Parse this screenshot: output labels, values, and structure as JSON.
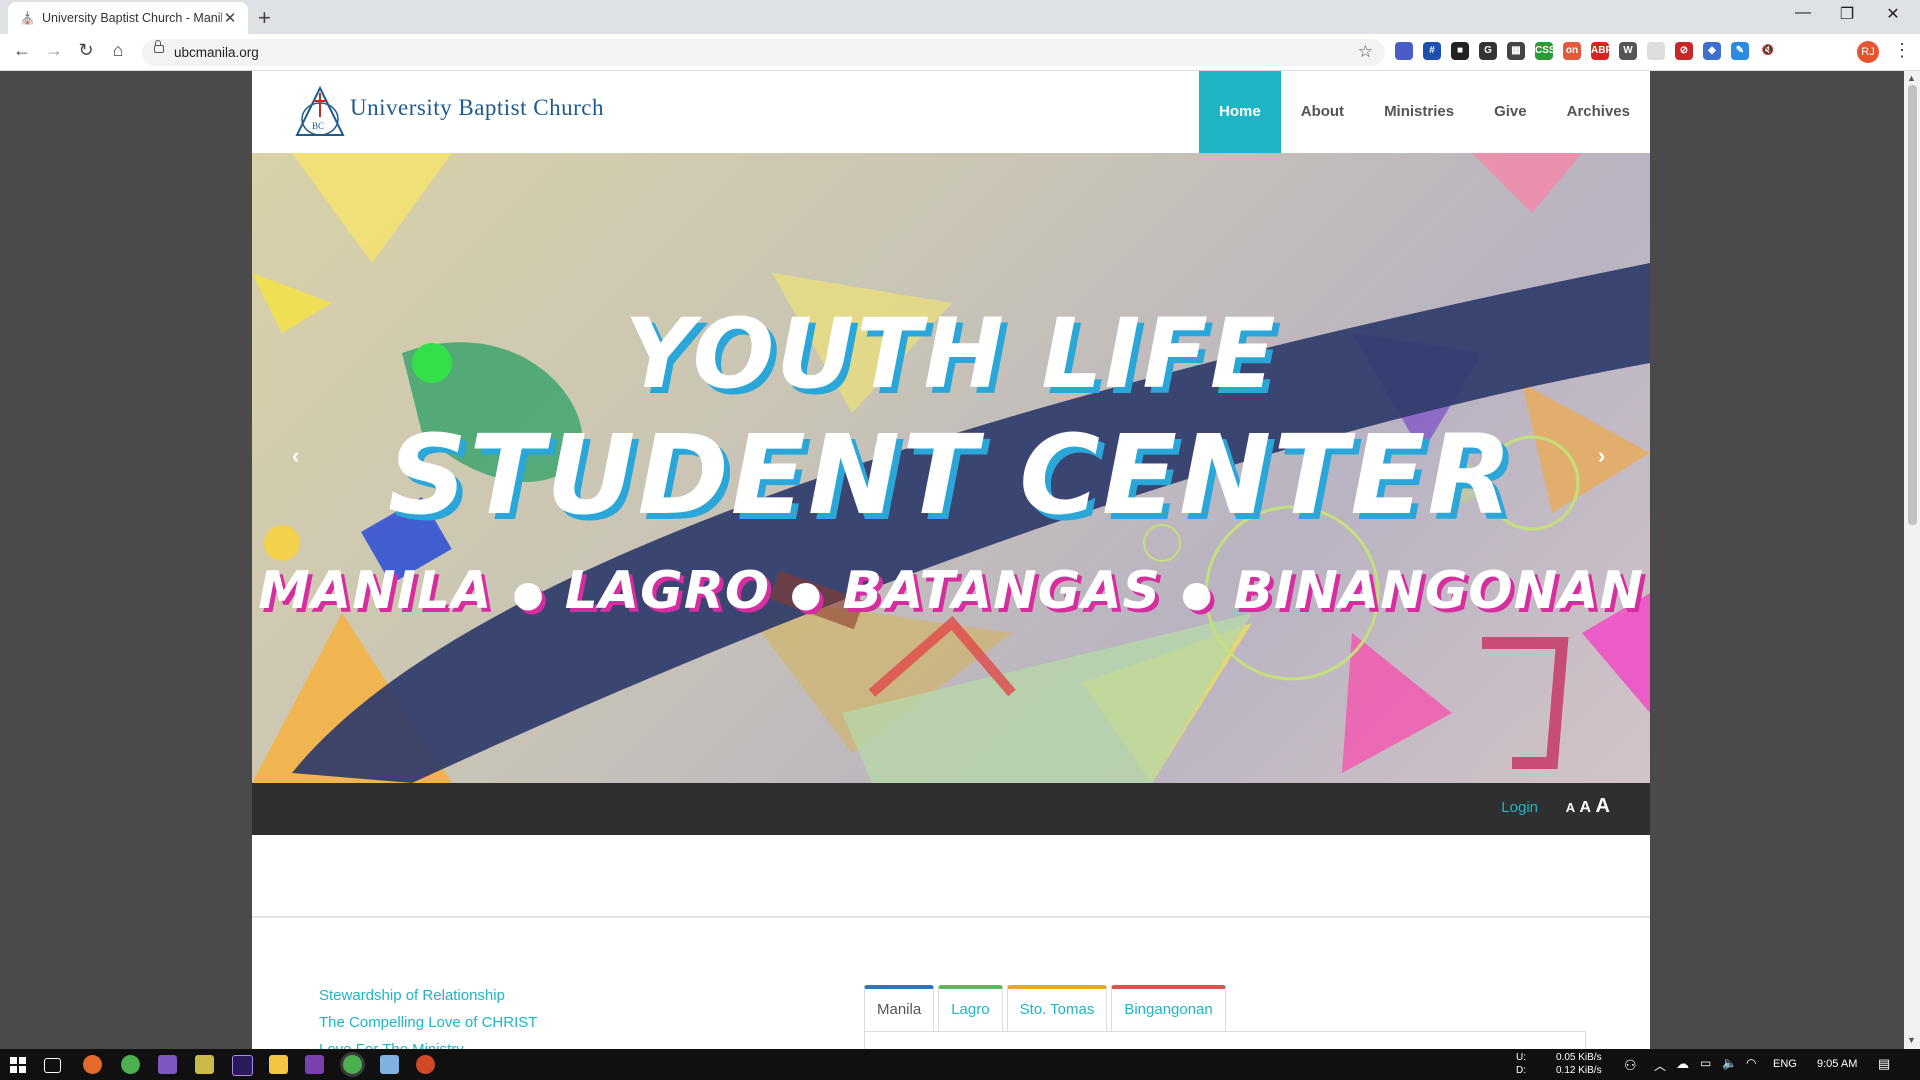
{
  "browser": {
    "tab_title": "University Baptist Church - Manila",
    "url": "ubcmanila.org",
    "window_controls": [
      "—",
      "❐",
      "✕"
    ],
    "extensions": [
      {
        "name": "shield-ext-icon",
        "color": "#4a5cc7",
        "label": ""
      },
      {
        "name": "frame-ext-icon",
        "color": "#1d4fb0",
        "label": "#"
      },
      {
        "name": "square-ext-icon",
        "color": "#222222",
        "label": "■"
      },
      {
        "name": "g-ext-icon",
        "color": "#333333",
        "label": "G"
      },
      {
        "name": "qr-ext-icon",
        "color": "#444444",
        "label": "▦"
      },
      {
        "name": "green-ext-icon",
        "color": "#2d9a3a",
        "label": "CSS"
      },
      {
        "name": "red-ext-icon",
        "color": "#e05a3c",
        "label": "on"
      },
      {
        "name": "abp-ext-icon",
        "color": "#d9231f",
        "label": "ABP"
      },
      {
        "name": "wp-ext-icon",
        "color": "#555555",
        "label": "W"
      },
      {
        "name": "blank-ext-icon",
        "color": "#dddddd",
        "label": ""
      },
      {
        "name": "block-ext-icon",
        "color": "#c62828",
        "label": "⊘"
      },
      {
        "name": "blue-ext-icon",
        "color": "#3d6fd1",
        "label": "◆"
      },
      {
        "name": "pen-ext-icon",
        "color": "#2a8be0",
        "label": "✎"
      },
      {
        "name": "mute-ext-icon",
        "color": "#ffffff",
        "label": "🔇"
      }
    ],
    "profile_initial": "RJ"
  },
  "site": {
    "brand": "University Baptist Church",
    "nav": [
      "Home",
      "About",
      "Ministries",
      "Give",
      "Archives"
    ],
    "active_nav": "Home",
    "hero": {
      "title_line1": "YOUTH LIFE",
      "title_line2": "STUDENT CENTER",
      "locations": [
        "MANILA",
        "LAGRO",
        "BATANGAS",
        "BINANGONAN"
      ]
    },
    "subbar": {
      "login": "Login",
      "font_sizes": [
        "A",
        "A",
        "A"
      ]
    },
    "articles": [
      "Stewardship of Relationship",
      "The Compelling Love of CHRIST",
      "Love For The Ministry"
    ],
    "tabs": [
      {
        "label": "Manila",
        "color": "#2a78c3"
      },
      {
        "label": "Lagro",
        "color": "#5cb85c"
      },
      {
        "label": "Sto. Tomas",
        "color": "#f0a030"
      },
      {
        "label": "Bingangonan",
        "color": "#d9534f"
      }
    ],
    "accent": "#1fb5c4"
  },
  "taskbar": {
    "net_up_label": "U:",
    "net_down_label": "D:",
    "net_up": "0.05 KiB/s",
    "net_down": "0.12 KiB/s",
    "language": "ENG",
    "time": "9:05 AM"
  }
}
